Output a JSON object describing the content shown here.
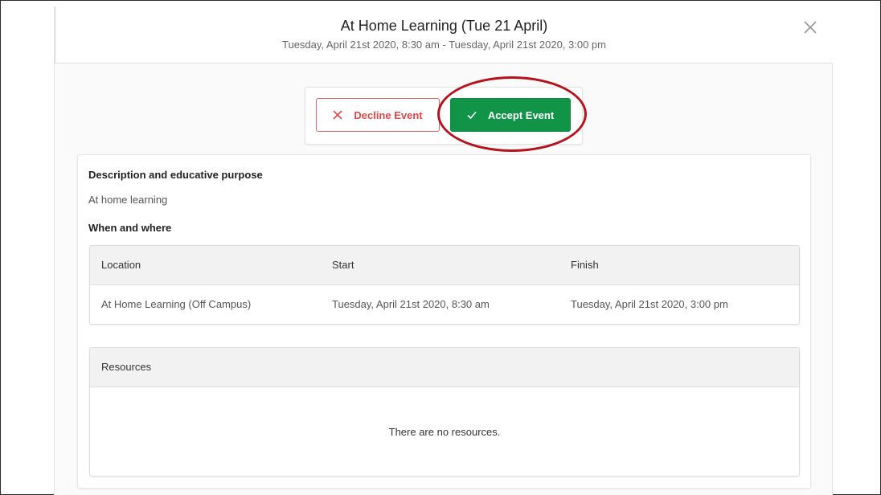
{
  "modal": {
    "title": "At Home Learning (Tue 21 April)",
    "subtitle": "Tuesday, April 21st 2020, 8:30 am - Tuesday, April 21st 2020, 3:00 pm",
    "close_icon": "close-icon"
  },
  "actions": {
    "decline_label": "Decline Event",
    "decline_icon": "x-icon",
    "accept_label": "Accept Event",
    "accept_icon": "check-icon",
    "colors": {
      "accept": "#119447",
      "decline": "#e04747",
      "highlight": "#b5121b"
    }
  },
  "details": {
    "description_heading": "Description and educative purpose",
    "description_text": "At home learning",
    "when_where_heading": "When and where",
    "table": {
      "headers": [
        "Location",
        "Start",
        "Finish"
      ],
      "rows": [
        [
          "At Home Learning (Off Campus)",
          "Tuesday, April 21st 2020, 8:30 am",
          "Tuesday, April 21st 2020, 3:00 pm"
        ]
      ]
    },
    "resources": {
      "heading": "Resources",
      "empty_text": "There are no resources."
    }
  }
}
